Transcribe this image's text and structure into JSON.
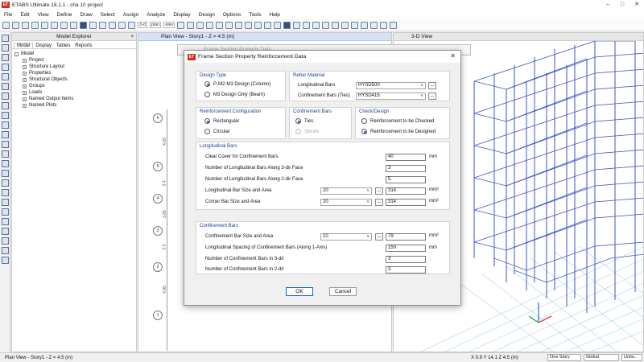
{
  "window": {
    "title": "ETABS Ultimate 18.1.1 - cha 10 project",
    "app_icon": "ET"
  },
  "menu": [
    "File",
    "Edit",
    "View",
    "Define",
    "Draw",
    "Select",
    "Assign",
    "Analyze",
    "Display",
    "Design",
    "Options",
    "Tools",
    "Help"
  ],
  "toolbar": {
    "view_3d": "3-d",
    "view_plan": "plan",
    "view_elev": "elev"
  },
  "explorer": {
    "title": "Model Explorer",
    "close": "×",
    "tabs": [
      "Model",
      "Display",
      "Tables",
      "Reports"
    ],
    "root": "Model",
    "items": [
      "Project",
      "Structure Layout",
      "Properties",
      "Structural Objects",
      "Groups",
      "Loads",
      "Named Output Items",
      "Named Plots"
    ]
  },
  "plan_view": {
    "title": "Plan View - Story1 - Z = 4.5 (m)",
    "bubbles": [
      "6",
      "5",
      "4",
      "3",
      "2",
      "1"
    ],
    "dims": [
      "4.95",
      "3.4",
      "3.85",
      "3.0",
      "4.95"
    ]
  },
  "view3d": {
    "title": "3-D View"
  },
  "ghost_dialog": {
    "title": "Frame Section Property Data"
  },
  "dialog": {
    "title": "Frame Section Property Reinforcement Data",
    "close": "✕",
    "design_type": {
      "label": "Design Type",
      "opt1": "P-M2-M3 Design (Column)",
      "opt2": "M3 Design Only (Beam)"
    },
    "rebar_material": {
      "label": "Rebar Material",
      "long_label": "Longitudinal Bars",
      "long_value": "HYSD500",
      "conf_label": "Confinement Bars (Ties)",
      "conf_value": "HYSD415"
    },
    "reinf_config": {
      "label": "Reinforcement Configuration",
      "opt1": "Rectangular",
      "opt2": "Circular"
    },
    "confinement_bars": {
      "label": "Confinement Bars",
      "opt1": "Ties",
      "opt2": "Spirals"
    },
    "check_design": {
      "label": "Check/Design",
      "opt1": "Reinforcement to be Checked",
      "opt2": "Reinforcement to be Designed"
    },
    "longitudinal": {
      "label": "Longitudinal Bars",
      "clear_cover_label": "Clear Cover for Confinement Bars",
      "clear_cover": "40",
      "clear_cover_unit": "mm",
      "bars3_label": "Number of Longitudinal Bars Along 3-dir Face",
      "bars3": "3",
      "bars2_label": "Number of Longitudinal Bars Along 2-dir Face",
      "bars2": "5",
      "size_label": "Longitudinal Bar Size and Area",
      "size": "20",
      "area": "314",
      "area_unit": "mm²",
      "corner_label": "Corner Bar Size and Area",
      "corner_size": "20",
      "corner_area": "314",
      "corner_unit": "mm²"
    },
    "confinement": {
      "label": "Confinement Bars",
      "size_label": "Confinement Bar Size and Area",
      "size": "10",
      "area": "79",
      "area_unit": "mm²",
      "spacing_label": "Longitudinal Spacing of Confinement Bars  (Along 1-Axis)",
      "spacing": "150",
      "spacing_unit": "mm",
      "n3_label": "Number of Confinement Bars in 3-dir",
      "n3": "3",
      "n2_label": "Number of Confinement Bars in 2-dir",
      "n2": "3"
    },
    "dots": "...",
    "ok": "OK",
    "cancel": "Cancel"
  },
  "status": {
    "left": "Plan View - Story1 - Z = 4.5 (m)",
    "coords": "X 0.9  Y 14.1  Z 4.5 (m)",
    "story": "One Story",
    "coord_sys": "Global",
    "units": "Units..."
  }
}
